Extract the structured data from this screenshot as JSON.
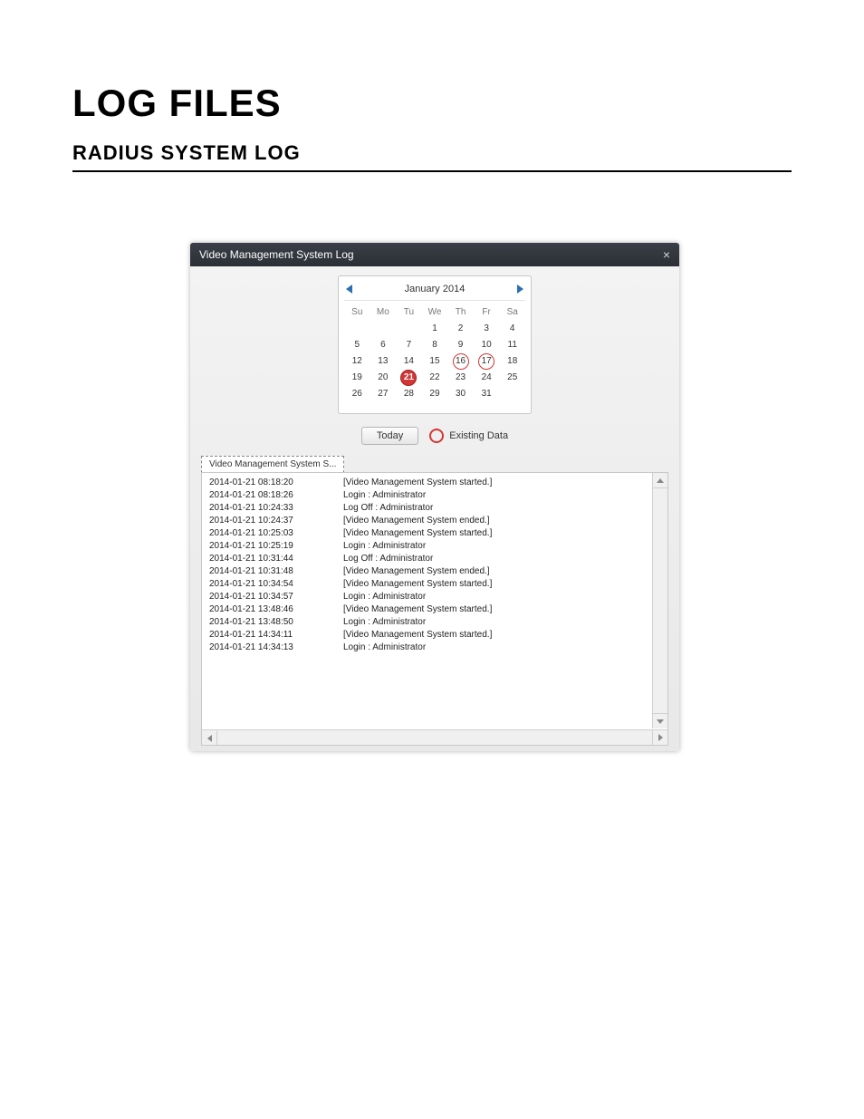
{
  "page": {
    "h1": "LOG FILES",
    "h2": "RADIUS SYSTEM LOG"
  },
  "window": {
    "title": "Video Management System Log",
    "close_glyph": "×",
    "calendar": {
      "month_label": "January 2014",
      "dow": [
        "Su",
        "Mo",
        "Tu",
        "We",
        "Th",
        "Fr",
        "Sa"
      ],
      "weeks": [
        [
          {
            "d": ""
          },
          {
            "d": ""
          },
          {
            "d": ""
          },
          {
            "d": "1"
          },
          {
            "d": "2"
          },
          {
            "d": "3"
          },
          {
            "d": "4"
          }
        ],
        [
          {
            "d": "5"
          },
          {
            "d": "6"
          },
          {
            "d": "7"
          },
          {
            "d": "8"
          },
          {
            "d": "9"
          },
          {
            "d": "10"
          },
          {
            "d": "11"
          }
        ],
        [
          {
            "d": "12"
          },
          {
            "d": "13"
          },
          {
            "d": "14"
          },
          {
            "d": "15"
          },
          {
            "d": "16",
            "ring": true
          },
          {
            "d": "17",
            "ring": true
          },
          {
            "d": "18"
          }
        ],
        [
          {
            "d": "19"
          },
          {
            "d": "20"
          },
          {
            "d": "21",
            "ring": true,
            "selected": true
          },
          {
            "d": "22"
          },
          {
            "d": "23"
          },
          {
            "d": "24"
          },
          {
            "d": "25"
          }
        ],
        [
          {
            "d": "26"
          },
          {
            "d": "27"
          },
          {
            "d": "28"
          },
          {
            "d": "29"
          },
          {
            "d": "30"
          },
          {
            "d": "31"
          },
          {
            "d": ""
          }
        ]
      ]
    },
    "today_button": "Today",
    "legend_label": "Existing Data",
    "tab_label": "Video Management System S...",
    "log": [
      {
        "ts": "2014-01-21 08:18:20",
        "msg": "[Video Management System started.]"
      },
      {
        "ts": "2014-01-21 08:18:26",
        "msg": "Login : Administrator"
      },
      {
        "ts": "2014-01-21 10:24:33",
        "msg": "Log Off : Administrator"
      },
      {
        "ts": "2014-01-21 10:24:37",
        "msg": "[Video Management System ended.]"
      },
      {
        "ts": "2014-01-21 10:25:03",
        "msg": "[Video Management System started.]"
      },
      {
        "ts": "2014-01-21 10:25:19",
        "msg": "Login : Administrator"
      },
      {
        "ts": "2014-01-21 10:31:44",
        "msg": "Log Off : Administrator"
      },
      {
        "ts": "2014-01-21 10:31:48",
        "msg": "[Video Management System ended.]"
      },
      {
        "ts": "2014-01-21 10:34:54",
        "msg": "[Video Management System started.]"
      },
      {
        "ts": "2014-01-21 10:34:57",
        "msg": "Login : Administrator"
      },
      {
        "ts": "2014-01-21 13:48:46",
        "msg": "[Video Management System started.]"
      },
      {
        "ts": "2014-01-21 13:48:50",
        "msg": "Login : Administrator"
      },
      {
        "ts": "2014-01-21 14:34:11",
        "msg": "[Video Management System started.]"
      },
      {
        "ts": "2014-01-21 14:34:13",
        "msg": "Login : Administrator"
      }
    ]
  }
}
